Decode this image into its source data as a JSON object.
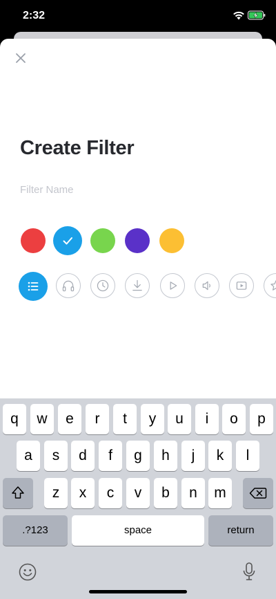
{
  "status": {
    "time": "2:32"
  },
  "sheet": {
    "title": "Create Filter",
    "name_placeholder": "Filter Name",
    "name_value": ""
  },
  "colors": [
    {
      "name": "red",
      "hex": "#ec3f40",
      "selected": false
    },
    {
      "name": "blue",
      "hex": "#1aa0e8",
      "selected": true
    },
    {
      "name": "green",
      "hex": "#78d54d",
      "selected": false
    },
    {
      "name": "purple",
      "hex": "#5a31c8",
      "selected": false
    },
    {
      "name": "yellow",
      "hex": "#fcbf33",
      "selected": false
    }
  ],
  "icons": [
    "list-icon",
    "headphones-icon",
    "clock-icon",
    "download-icon",
    "play-icon",
    "volume-icon",
    "video-icon",
    "star-icon"
  ],
  "keyboard": {
    "row1": [
      "q",
      "w",
      "e",
      "r",
      "t",
      "y",
      "u",
      "i",
      "o",
      "p"
    ],
    "row2": [
      "a",
      "s",
      "d",
      "f",
      "g",
      "h",
      "j",
      "k",
      "l"
    ],
    "row3": [
      "z",
      "x",
      "c",
      "v",
      "b",
      "n",
      "m"
    ],
    "numbers_label": ".?123",
    "space_label": "space",
    "return_label": "return"
  }
}
